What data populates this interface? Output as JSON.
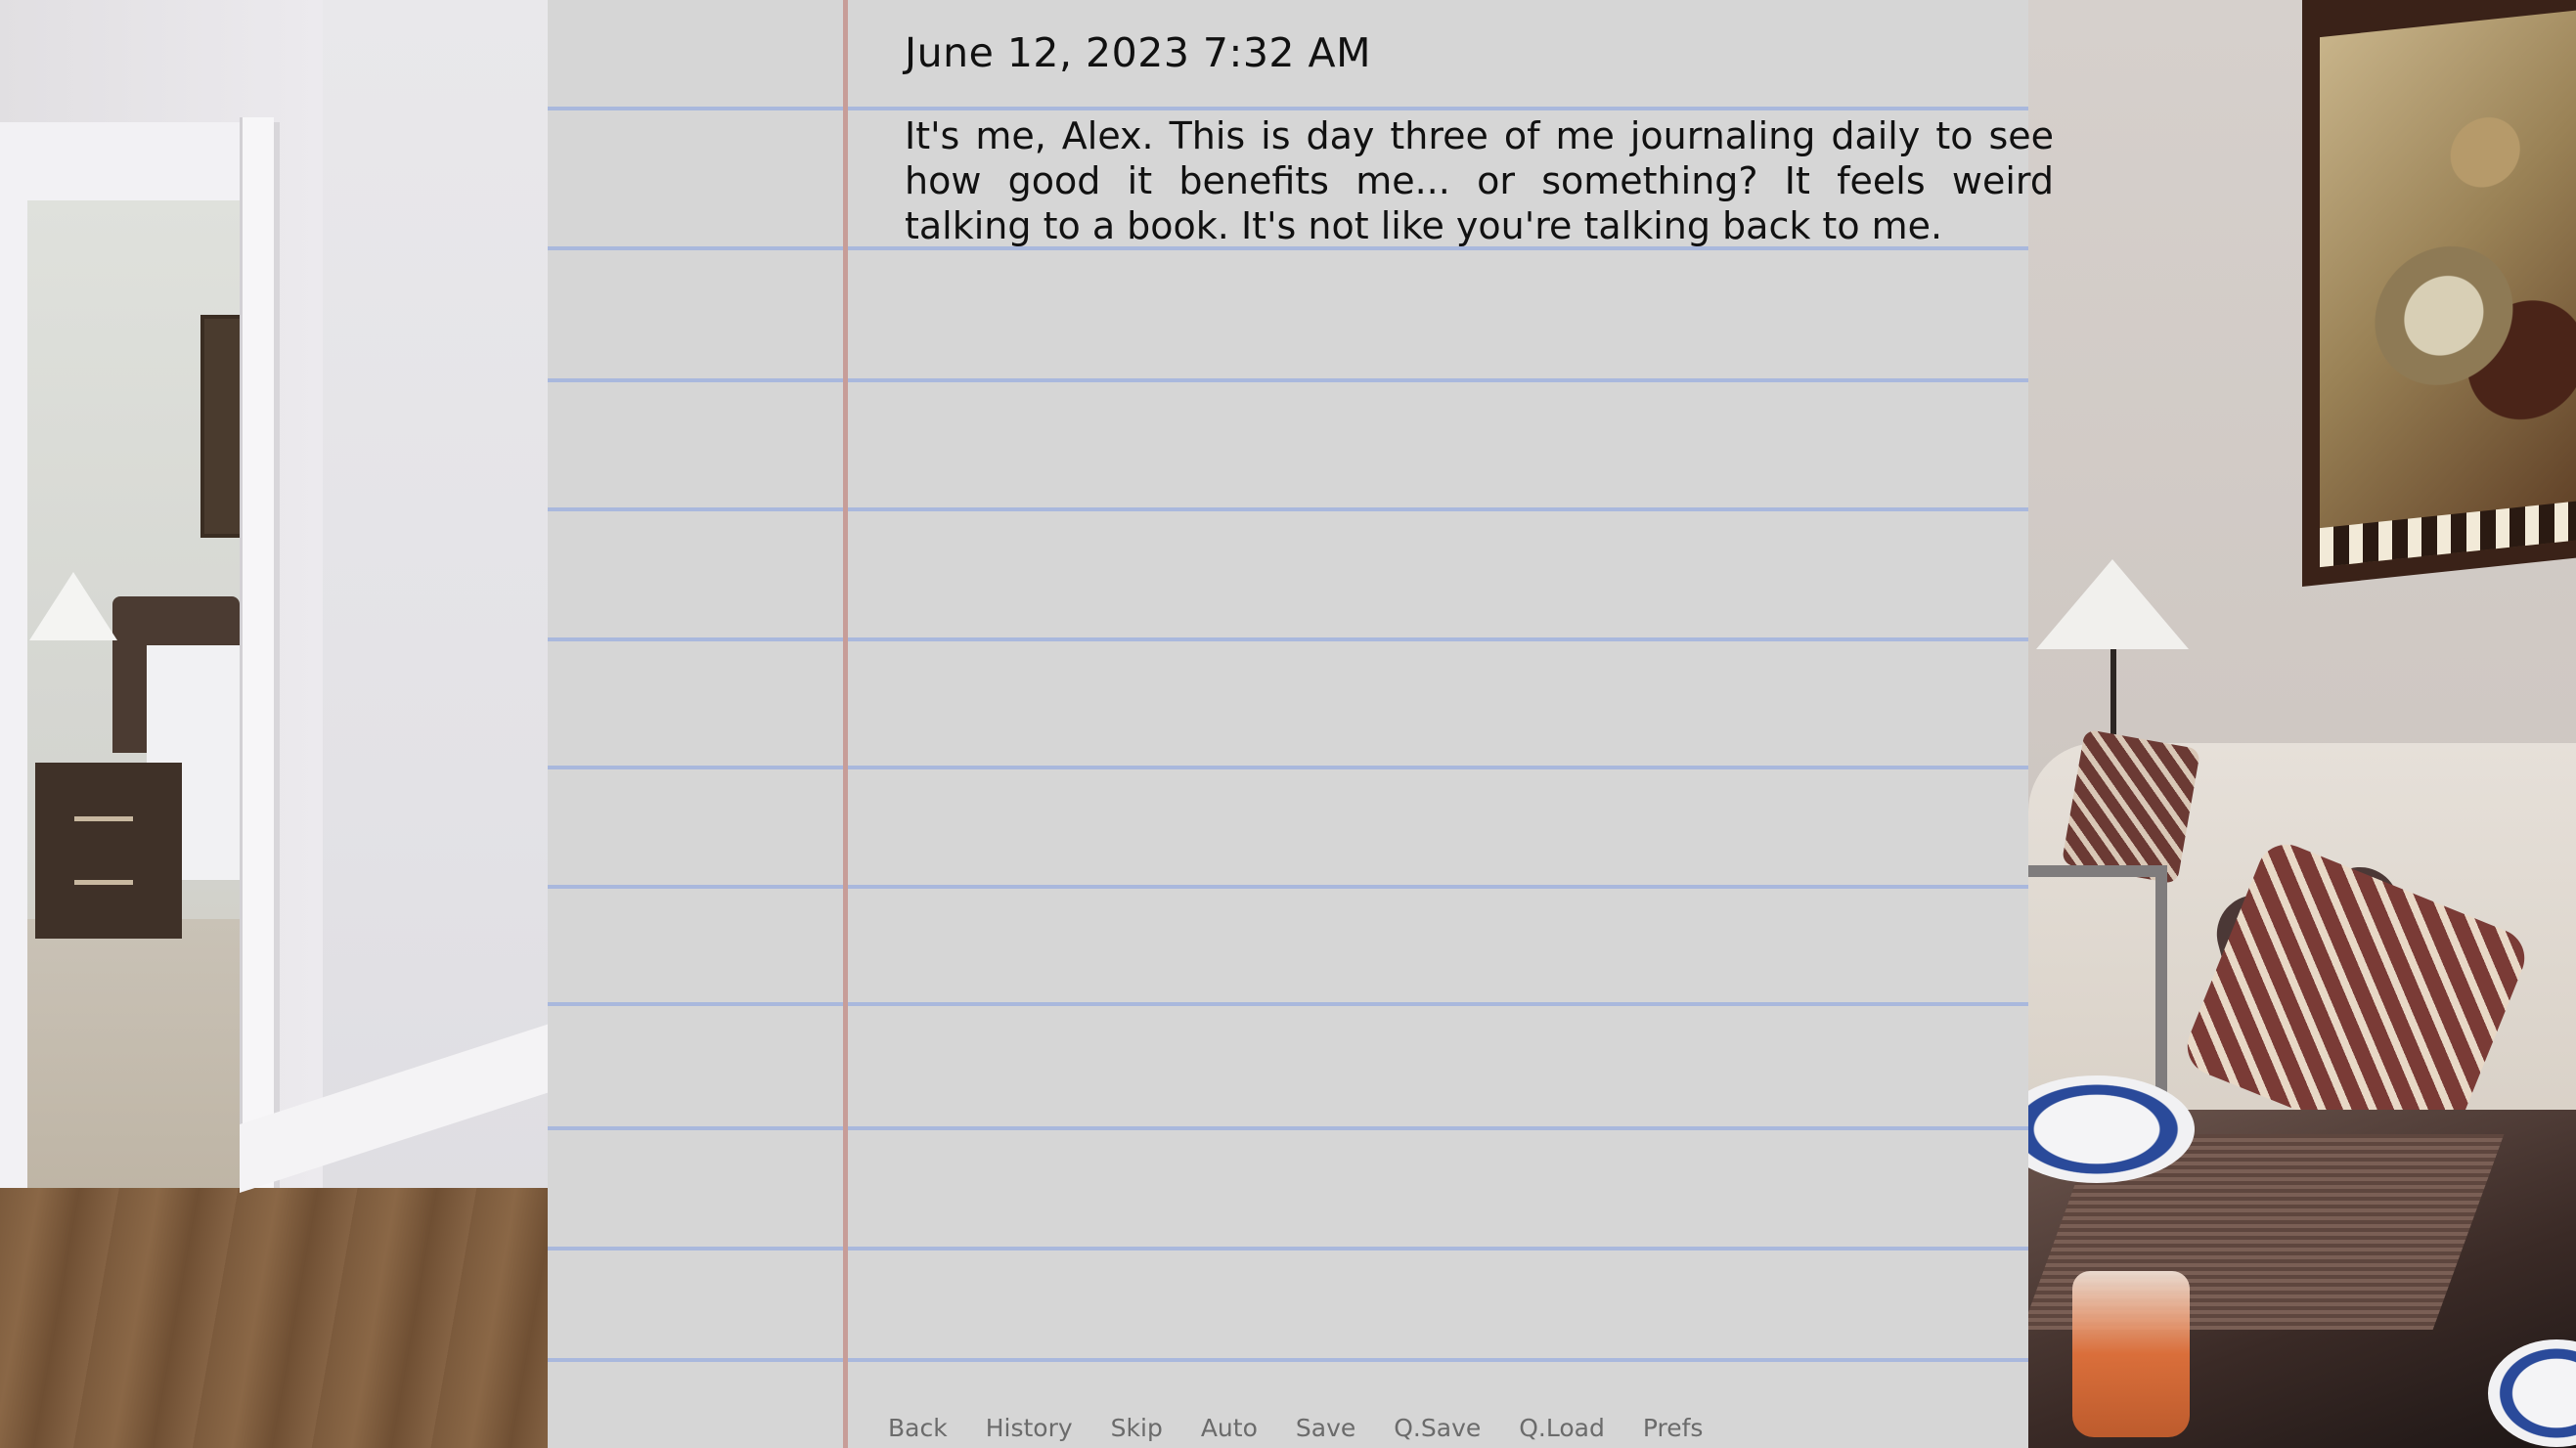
{
  "journal": {
    "date": "June 12, 2023 7:32 AM",
    "entry": "It's me, Alex. This is day three of me journaling daily to see how good it benefits me... or something? It feels weird talking to a book. It's not like you're talking back to me."
  },
  "quick_menu": {
    "back": "Back",
    "history": "History",
    "skip": "Skip",
    "auto": "Auto",
    "save": "Save",
    "qsave": "Q.Save",
    "qload": "Q.Load",
    "prefs": "Prefs"
  },
  "colors": {
    "paper": "#d6d6d6",
    "rule_line": "#a9b8dd",
    "margin_line": "#c79d98",
    "ink": "#111111",
    "menu_text": "#6b6b6b"
  }
}
